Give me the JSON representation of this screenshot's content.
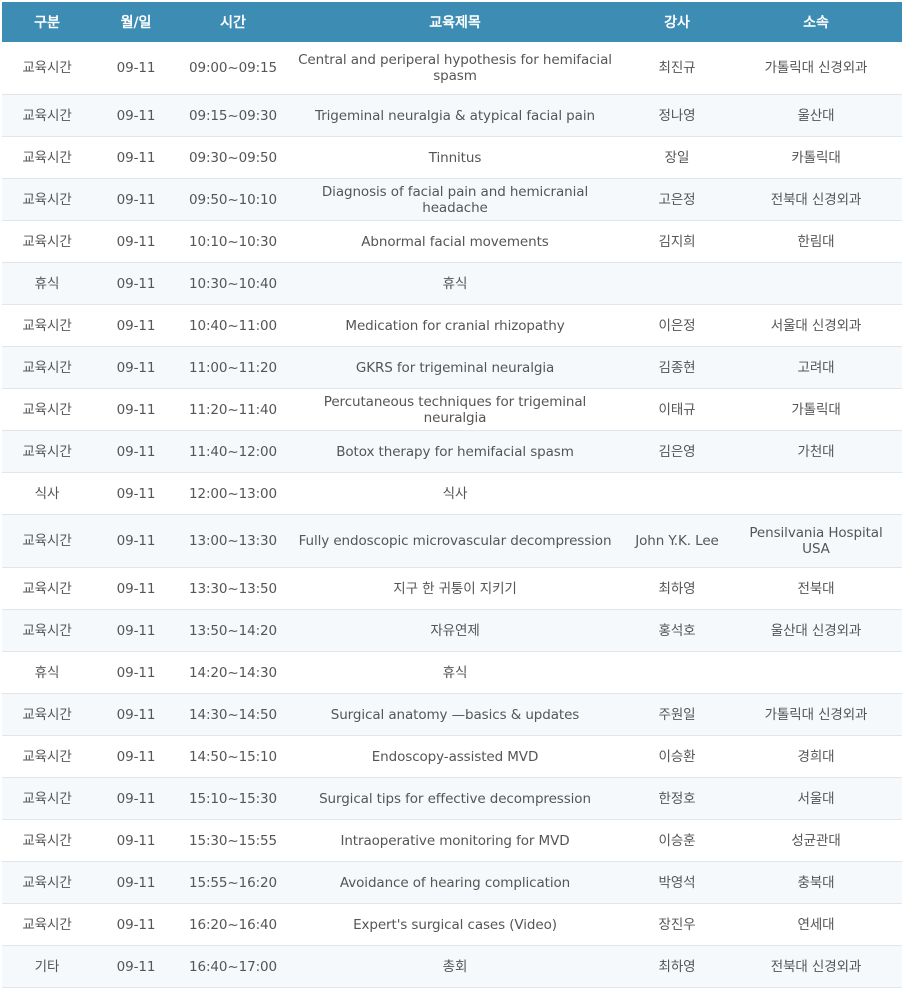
{
  "headers": {
    "category": "구분",
    "date": "월/일",
    "time": "시간",
    "title": "교육제목",
    "speaker": "강사",
    "affiliation": "소속"
  },
  "rows": [
    {
      "category": "교육시간",
      "date": "09-11",
      "time": "09:00~09:15",
      "title": "Central and periperal hypothesis for hemifacial spasm",
      "speaker": "최진규",
      "affiliation": "가톨릭대 신경외과"
    },
    {
      "category": "교육시간",
      "date": "09-11",
      "time": "09:15~09:30",
      "title": "Trigeminal neuralgia & atypical facial pain",
      "speaker": "정나영",
      "affiliation": "울산대"
    },
    {
      "category": "교육시간",
      "date": "09-11",
      "time": "09:30~09:50",
      "title": "Tinnitus",
      "speaker": "장일",
      "affiliation": "카톨릭대"
    },
    {
      "category": "교육시간",
      "date": "09-11",
      "time": "09:50~10:10",
      "title": "Diagnosis of facial pain and hemicranial headache",
      "speaker": "고은정",
      "affiliation": "전북대 신경외과"
    },
    {
      "category": "교육시간",
      "date": "09-11",
      "time": "10:10~10:30",
      "title": "Abnormal facial movements",
      "speaker": "김지희",
      "affiliation": "한림대"
    },
    {
      "category": "휴식",
      "date": "09-11",
      "time": "10:30~10:40",
      "title": "휴식",
      "speaker": "",
      "affiliation": ""
    },
    {
      "category": "교육시간",
      "date": "09-11",
      "time": "10:40~11:00",
      "title": "Medication for cranial rhizopathy",
      "speaker": "이은정",
      "affiliation": "서울대 신경외과"
    },
    {
      "category": "교육시간",
      "date": "09-11",
      "time": "11:00~11:20",
      "title": "GKRS for trigeminal neuralgia",
      "speaker": "김종현",
      "affiliation": "고려대"
    },
    {
      "category": "교육시간",
      "date": "09-11",
      "time": "11:20~11:40",
      "title": "Percutaneous techniques for trigeminal neuralgia",
      "speaker": "이태규",
      "affiliation": "가톨릭대"
    },
    {
      "category": "교육시간",
      "date": "09-11",
      "time": "11:40~12:00",
      "title": "Botox therapy for hemifacial spasm",
      "speaker": "김은영",
      "affiliation": "가천대"
    },
    {
      "category": "식사",
      "date": "09-11",
      "time": "12:00~13:00",
      "title": "식사",
      "speaker": "",
      "affiliation": ""
    },
    {
      "category": "교육시간",
      "date": "09-11",
      "time": "13:00~13:30",
      "title": "Fully endoscopic microvascular decompression",
      "speaker": "John Y.K. Lee",
      "affiliation": "Pensilvania Hospital USA"
    },
    {
      "category": "교육시간",
      "date": "09-11",
      "time": "13:30~13:50",
      "title": "지구 한 귀퉁이 지키기",
      "speaker": "최하영",
      "affiliation": "전북대"
    },
    {
      "category": "교육시간",
      "date": "09-11",
      "time": "13:50~14:20",
      "title": "자유연제",
      "speaker": "홍석호",
      "affiliation": "울산대 신경외과"
    },
    {
      "category": "휴식",
      "date": "09-11",
      "time": "14:20~14:30",
      "title": "휴식",
      "speaker": "",
      "affiliation": ""
    },
    {
      "category": "교육시간",
      "date": "09-11",
      "time": "14:30~14:50",
      "title": "Surgical anatomy —basics & updates",
      "speaker": "주원일",
      "affiliation": "가톨릭대 신경외과"
    },
    {
      "category": "교육시간",
      "date": "09-11",
      "time": "14:50~15:10",
      "title": "Endoscopy-assisted MVD",
      "speaker": "이승환",
      "affiliation": "경희대"
    },
    {
      "category": "교육시간",
      "date": "09-11",
      "time": "15:10~15:30",
      "title": "Surgical tips for effective decompression",
      "speaker": "한정호",
      "affiliation": "서울대"
    },
    {
      "category": "교육시간",
      "date": "09-11",
      "time": "15:30~15:55",
      "title": "Intraoperative monitoring for MVD",
      "speaker": "이승훈",
      "affiliation": "성균관대"
    },
    {
      "category": "교육시간",
      "date": "09-11",
      "time": "15:55~16:20",
      "title": "Avoidance of hearing complication",
      "speaker": "박영석",
      "affiliation": "충북대"
    },
    {
      "category": "교육시간",
      "date": "09-11",
      "time": "16:20~16:40",
      "title": "Expert's surgical cases (Video)",
      "speaker": "장진우",
      "affiliation": "연세대"
    },
    {
      "category": "기타",
      "date": "09-11",
      "time": "16:40~17:00",
      "title": "총회",
      "speaker": "최하영",
      "affiliation": "전북대 신경외과"
    }
  ],
  "colors": {
    "header_bg": "#3c8cb4",
    "header_text": "#ffffff",
    "body_text": "#555555",
    "row_alt_bg": "#f6f9fb",
    "row_border": "#e1e6ea"
  }
}
